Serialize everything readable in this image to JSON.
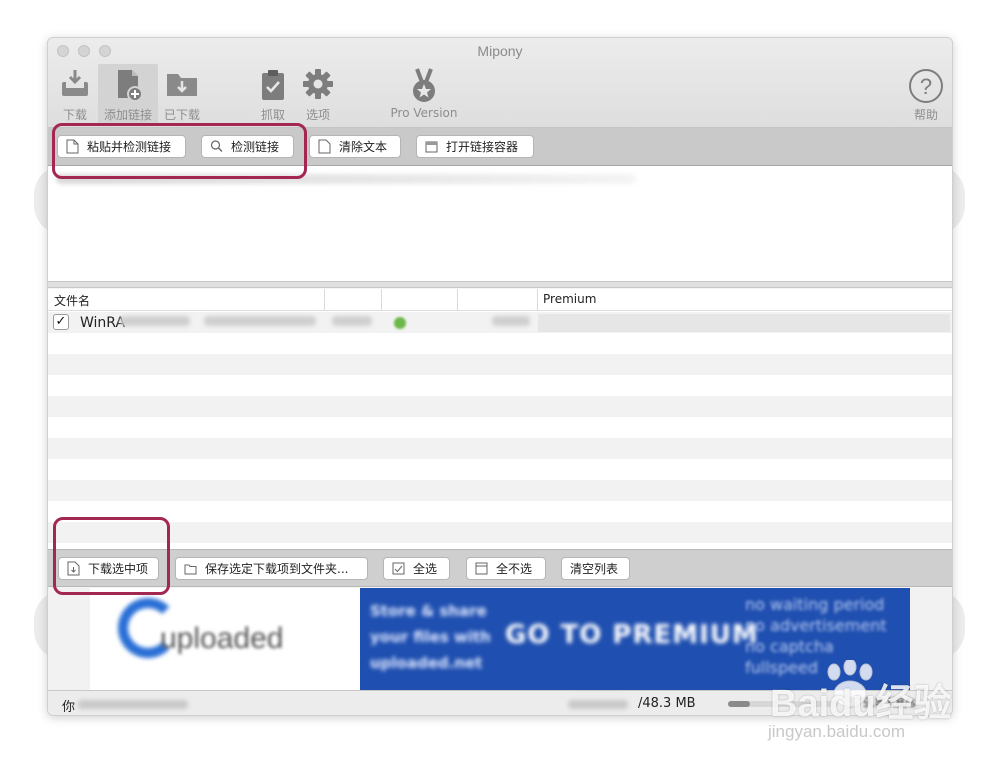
{
  "app": {
    "title": "Mipony"
  },
  "toolbar": {
    "download": "下载",
    "add_links": "添加链接",
    "downloaded": "已下载",
    "capture": "抓取",
    "options": "选项",
    "pro_version": "Pro Version",
    "help": "帮助"
  },
  "link_bar": {
    "paste_check": "粘贴并检测链接",
    "check": "检测链接",
    "clear": "清除文本",
    "open_container": "打开链接容器"
  },
  "table": {
    "columns": [
      "文件名",
      "Premium"
    ],
    "blurred_header": "",
    "rows": [
      {
        "check_mark": "✓",
        "filename": "WinRA",
        "checked": true
      }
    ]
  },
  "action_bar": {
    "download_selected": "下载选中项",
    "save_to_folder": "保存选定下载项到文件夹...",
    "select_all": "全选",
    "select_none": "全不选",
    "clear_list": "清空列表"
  },
  "ad": {
    "brand": "uploaded",
    "tagline": [
      "Store & share",
      "your files with",
      "uploaded.net"
    ],
    "headline": "GO TO PREMIUM",
    "features": [
      "no waiting period",
      "no advertisement",
      "no captcha",
      "fullspeed"
    ]
  },
  "status": {
    "message_prefix": "你",
    "size": "/48.3 MB",
    "speed": "379.8 KB/s",
    "speed_limit_fraction": 0.2
  },
  "watermark": {
    "brand": "Baidu经验",
    "url": "jingyan.baidu.com"
  },
  "colors": {
    "annotation": "#a3284f",
    "ad_blue": "#1f4fb0",
    "status_green": "#6cb84a"
  }
}
